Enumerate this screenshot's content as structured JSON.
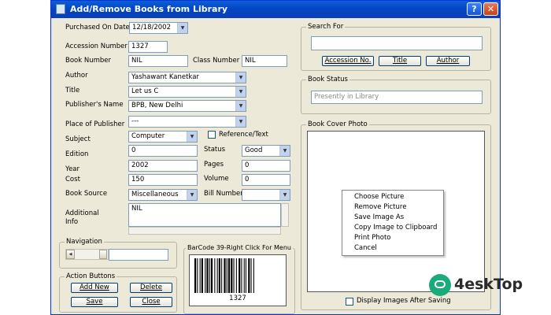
{
  "window": {
    "title": "Add/Remove Books from Library",
    "help": "?",
    "close": "✕"
  },
  "form": {
    "purchased_on_date": {
      "label": "Purchased On Date",
      "value": "12/18/2002"
    },
    "accession_number": {
      "label": "Accession Number",
      "value": "1327"
    },
    "book_number": {
      "label": "Book Number",
      "value": "NIL"
    },
    "class_number": {
      "label": "Class Number",
      "value": "NIL"
    },
    "author": {
      "label": "Author",
      "value": "Yashawant Kanetkar"
    },
    "title": {
      "label": "Title",
      "value": "Let us C"
    },
    "publishers_name": {
      "label": "Publisher's Name",
      "value": "BPB, New Delhi"
    },
    "place_of_publisher": {
      "label": "Place of Publisher",
      "value": "---"
    },
    "subject": {
      "label": "Subject",
      "value": "Computer"
    },
    "reference_text": {
      "label": "Reference/Text"
    },
    "edition": {
      "label": "Edition",
      "value": "0"
    },
    "status": {
      "label": "Status",
      "value": "Good"
    },
    "year": {
      "label": "Year",
      "value": "2002"
    },
    "pages": {
      "label": "Pages",
      "value": "0"
    },
    "cost": {
      "label": "Cost",
      "value": "150"
    },
    "volume": {
      "label": "Volume",
      "value": "0"
    },
    "book_source": {
      "label": "Book Source",
      "value": "Miscellaneous"
    },
    "bill_number": {
      "label": "Bill Number",
      "value": ""
    },
    "additional_info": {
      "label_line1": "Additional",
      "label_line2": "Info",
      "value": "NIL"
    }
  },
  "navigation": {
    "label": "Navigation",
    "value": ""
  },
  "barcode": {
    "label": "BarCode 39-Right Click For Menu",
    "value": "1327"
  },
  "action_buttons": {
    "label": "Action Buttons",
    "add_new": "Add New",
    "delete": "Delete",
    "save": "Save",
    "close": "Close"
  },
  "search": {
    "label": "Search For",
    "value": "",
    "accession_no": "Accession No.",
    "title": "Title",
    "author": "Author"
  },
  "book_status": {
    "label": "Book Status",
    "value": "Presently in Library"
  },
  "book_cover": {
    "label": "Book Cover Photo",
    "display_after_saving": "Display Images After Saving"
  },
  "context_menu": [
    "Choose Picture",
    "Remove Picture",
    "Save Image As",
    "Copy Image to Clipboard",
    "Print Photo",
    "Cancel"
  ],
  "watermark": {
    "text": "4eskTop"
  },
  "colors": {
    "titlebar": "#0347c4",
    "window_bg": "#ece9d8",
    "field_border": "#7f9db9",
    "watermark_accent": "#1bab7a"
  }
}
